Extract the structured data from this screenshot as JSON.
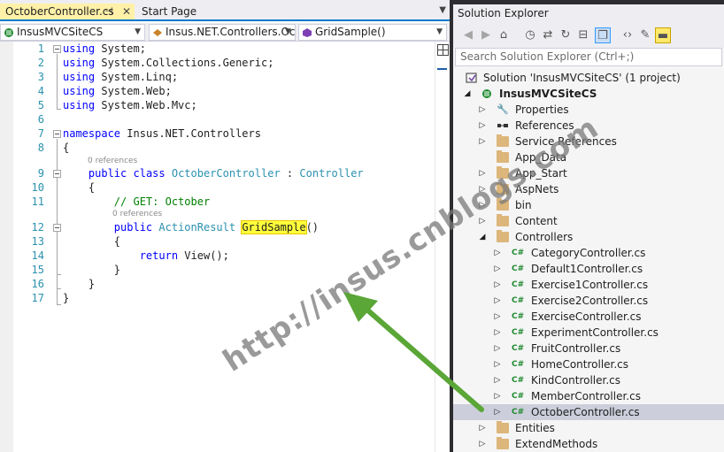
{
  "editor": {
    "tabs": [
      {
        "label": "OctoberController.cs",
        "active": true
      },
      {
        "label": "Start Page",
        "active": false
      }
    ],
    "nav": {
      "project": "InsusMVCSiteCS",
      "class": "Insus.NET.Controllers.Oc",
      "member": "GridSample()"
    },
    "line_numbers": [
      "1",
      "2",
      "3",
      "4",
      "5",
      "6",
      "7",
      "8",
      "9",
      "10",
      "11",
      "12",
      "13",
      "14",
      "15",
      "16",
      "17"
    ],
    "code": {
      "l1": "System;",
      "l2": "System.Collections.Generic;",
      "l3": "System.Linq;",
      "l4": "System.Web;",
      "l5": "System.Web.Mvc;",
      "l7": "Insus.NET.Controllers",
      "kw_using": "using",
      "kw_namespace": "namespace",
      "kw_public": "public",
      "kw_class": "class",
      "kw_return": "return",
      "class_name": "OctoberController",
      "base_class": "Controller",
      "colon": ":",
      "comment": "// GET: October",
      "return_type": "ActionResult",
      "method_name": "GridSample",
      "parens": "()",
      "return_expr": "View();",
      "brace_open": "{",
      "brace_close": "}"
    },
    "codelens": [
      "0 references",
      "0 references"
    ]
  },
  "watermark": "http://insus.cnblogs.com",
  "solution_explorer": {
    "title": "Solution Explorer",
    "search_placeholder": "Search Solution Explorer (Ctrl+;)",
    "solution_label": "Solution 'InsusMVCSiteCS' (1 project)",
    "project_label": "InsusMVCSiteCS",
    "items": [
      {
        "label": "Properties",
        "icon": "wrench-icon"
      },
      {
        "label": "References",
        "icon": "references-icon"
      },
      {
        "label": "Service References",
        "icon": "folder-icon"
      },
      {
        "label": "App_Data",
        "icon": "folder-icon"
      },
      {
        "label": "App_Start",
        "icon": "folder-icon"
      },
      {
        "label": "AspNets",
        "icon": "folder-icon"
      },
      {
        "label": "bin",
        "icon": "folder-icon"
      },
      {
        "label": "Content",
        "icon": "folder-icon"
      },
      {
        "label": "Controllers",
        "icon": "folder-icon",
        "expanded": true
      }
    ],
    "controllers": [
      "CategoryController.cs",
      "Default1Controller.cs",
      "Exercise1Controller.cs",
      "Exercise2Controller.cs",
      "ExerciseController.cs",
      "ExperimentController.cs",
      "FruitController.cs",
      "HomeController.cs",
      "KindController.cs",
      "MemberController.cs",
      "OctoberController.cs"
    ],
    "selected_file": "OctoberController.cs",
    "after_items": [
      {
        "label": "Entities",
        "icon": "folder-icon"
      },
      {
        "label": "ExtendMethods",
        "icon": "folder-icon"
      }
    ],
    "cs_badge": "C#"
  },
  "colors": {
    "accent": "#007acc",
    "active_tab": "#fff1a8",
    "highlight": "#ffff3b",
    "arrow": "#5aa637",
    "selected_row": "#cccedb"
  }
}
